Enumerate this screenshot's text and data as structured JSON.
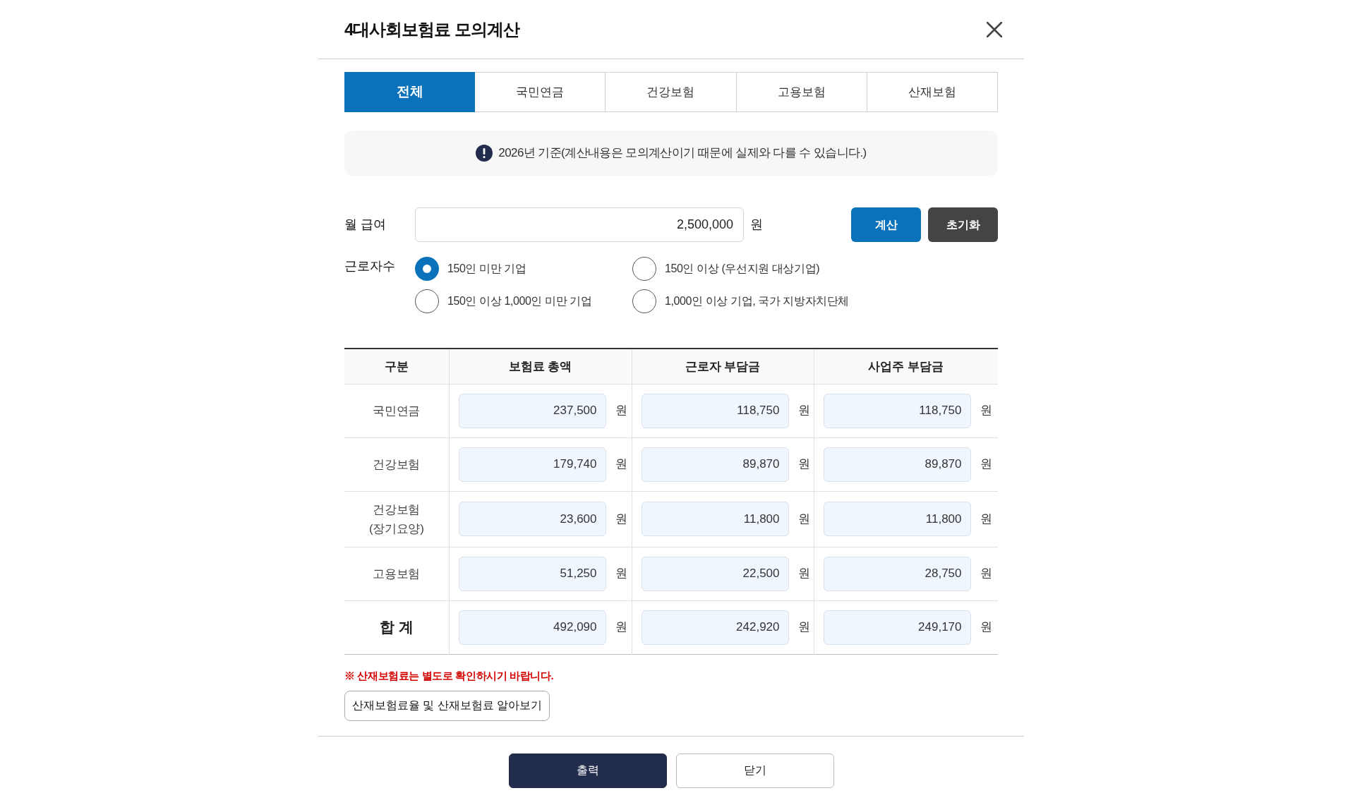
{
  "dialog": {
    "title": "4대사회보험료 모의계산"
  },
  "tabs": [
    {
      "label": "전체",
      "selected": true
    },
    {
      "label": "국민연금",
      "selected": false
    },
    {
      "label": "건강보험",
      "selected": false
    },
    {
      "label": "고용보험",
      "selected": false
    },
    {
      "label": "산재보험",
      "selected": false
    }
  ],
  "notice": {
    "text": "2026년 기준(계산내용은 모의계산이기 때문에 실제와 다를 수 있습니다.)"
  },
  "salary": {
    "label": "월 급여",
    "value": "2,500,000",
    "unit": "원"
  },
  "actions": [
    {
      "label": "계산",
      "kind": "primary"
    },
    {
      "label": "초기화",
      "kind": "secondary"
    }
  ],
  "workers": {
    "label": "근로자수",
    "options": [
      {
        "label": "150인 미만 기업",
        "selected": true
      },
      {
        "label": "150인 이상 (우선지원 대상기업)",
        "selected": false
      },
      {
        "label": "150인 이상 1,000인 미만 기업",
        "selected": false
      },
      {
        "label": "1,000인 이상 기업, 국가 지방자치단체",
        "selected": false
      }
    ]
  },
  "table": {
    "columns": [
      "구분",
      "보험료 총액",
      "근로자 부담금",
      "사업주 부담금"
    ],
    "rows": [
      {
        "kind": "item",
        "cells": [
          {
            "text": "국민연금"
          },
          {
            "value": "237,500",
            "unit": "원"
          },
          {
            "value": "118,750",
            "unit": "원"
          },
          {
            "value": "118,750",
            "unit": "원"
          }
        ]
      },
      {
        "kind": "item",
        "cells": [
          {
            "text": "건강보험"
          },
          {
            "value": "179,740",
            "unit": "원"
          },
          {
            "value": "89,870",
            "unit": "원"
          },
          {
            "value": "89,870",
            "unit": "원"
          }
        ]
      },
      {
        "kind": "item",
        "cells": [
          {
            "text": "건강보험\n(장기요양)"
          },
          {
            "value": "23,600",
            "unit": "원"
          },
          {
            "value": "11,800",
            "unit": "원"
          },
          {
            "value": "11,800",
            "unit": "원"
          }
        ]
      },
      {
        "kind": "item",
        "cells": [
          {
            "text": "고용보험"
          },
          {
            "value": "51,250",
            "unit": "원"
          },
          {
            "value": "22,500",
            "unit": "원"
          },
          {
            "value": "28,750",
            "unit": "원"
          }
        ]
      },
      {
        "kind": "total",
        "cells": [
          {
            "text": "합 계"
          },
          {
            "value": "492,090",
            "unit": "원"
          },
          {
            "value": "242,920",
            "unit": "원"
          },
          {
            "value": "249,170",
            "unit": "원"
          }
        ]
      }
    ]
  },
  "warning": {
    "text": "※ 산재보험료는 별도로 확인하시기 바랍니다."
  },
  "link_button": {
    "label": "산재보험료율 및 산재보험료 알아보기"
  },
  "footer_buttons": [
    {
      "label": "출력",
      "kind": "primary"
    },
    {
      "label": "닫기",
      "kind": "outline"
    }
  ]
}
